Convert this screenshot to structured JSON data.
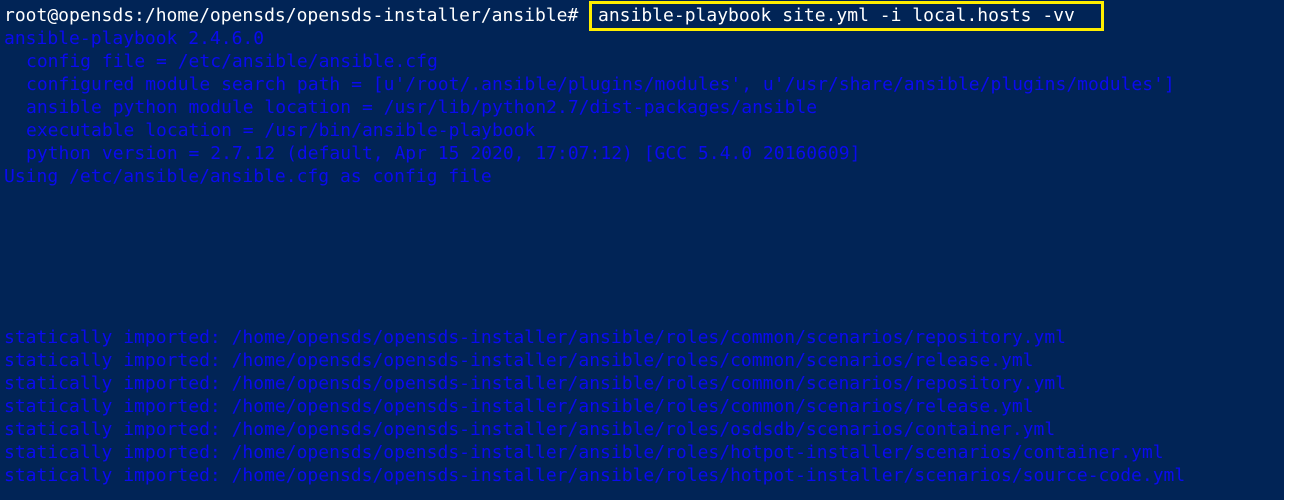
{
  "terminal": {
    "prompt": "root@opensds:/home/opensds/opensds-installer/ansible#",
    "command": "ansible-playbook site.yml -i local.hosts -vv",
    "output_top": [
      "ansible-playbook 2.4.6.0",
      "config file = /etc/ansible/ansible.cfg",
      "configured module search path = [u'/root/.ansible/plugins/modules', u'/usr/share/ansible/plugins/modules']",
      "ansible python module location = /usr/lib/python2.7/dist-packages/ansible",
      "executable location = /usr/bin/ansible-playbook",
      "python version = 2.7.12 (default, Apr 15 2020, 17:07:12) [GCC 5.4.0 20160609]",
      "Using /etc/ansible/ansible.cfg as config file"
    ],
    "output_bottom": [
      "statically imported: /home/opensds/opensds-installer/ansible/roles/common/scenarios/repository.yml",
      "statically imported: /home/opensds/opensds-installer/ansible/roles/common/scenarios/release.yml",
      "statically imported: /home/opensds/opensds-installer/ansible/roles/common/scenarios/repository.yml",
      "statically imported: /home/opensds/opensds-installer/ansible/roles/common/scenarios/release.yml",
      "statically imported: /home/opensds/opensds-installer/ansible/roles/osdsdb/scenarios/container.yml",
      "statically imported: /home/opensds/opensds-installer/ansible/roles/hotpot-installer/scenarios/container.yml",
      "statically imported: /home/opensds/opensds-installer/ansible/roles/hotpot-installer/scenarios/source-code.yml"
    ],
    "colors": {
      "background": "#012456",
      "prompt": "#ffffff",
      "output": "#0a0af0",
      "highlight_box": "#ffee00"
    }
  }
}
